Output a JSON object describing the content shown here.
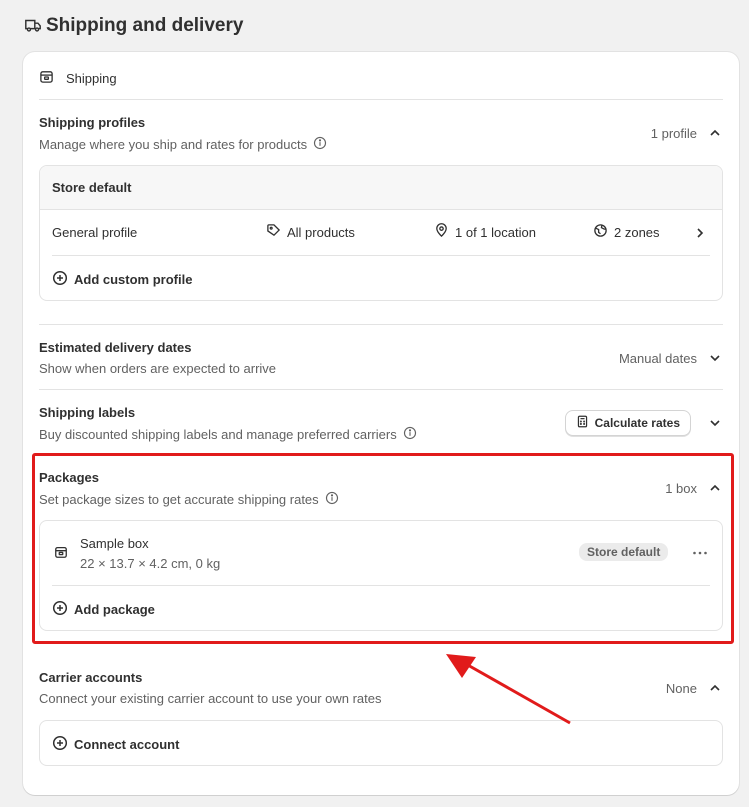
{
  "page": {
    "title": "Shipping and delivery",
    "title_icon": "truck-icon"
  },
  "card": {
    "header_label": "Shipping",
    "header_icon": "package-icon"
  },
  "shipping_profiles": {
    "title": "Shipping profiles",
    "description": "Manage where you ship and rates for products",
    "count": "1 profile",
    "group_header": "Store default",
    "profile": {
      "name": "General profile",
      "products": "All products",
      "locations": "1 of 1 location",
      "zones": "2 zones"
    },
    "add_label": "Add custom profile"
  },
  "delivery_dates": {
    "title": "Estimated delivery dates",
    "description": "Show when orders are expected to arrive",
    "value": "Manual dates"
  },
  "shipping_labels": {
    "title": "Shipping labels",
    "description": "Buy discounted shipping labels and manage preferred carriers",
    "button_label": "Calculate rates"
  },
  "packages": {
    "title": "Packages",
    "description": "Set package sizes to get accurate shipping rates",
    "count": "1 box",
    "item": {
      "name": "Sample box",
      "dimensions": "22 × 13.7 × 4.2 cm, 0 kg",
      "badge": "Store default"
    },
    "add_label": "Add package"
  },
  "carrier_accounts": {
    "title": "Carrier accounts",
    "description": "Connect your existing carrier account to use your own rates",
    "value": "None",
    "add_label": "Connect account"
  },
  "colors": {
    "highlight": "#e11b1b",
    "card_bg": "#ffffff",
    "page_bg": "#f1f1f1"
  }
}
